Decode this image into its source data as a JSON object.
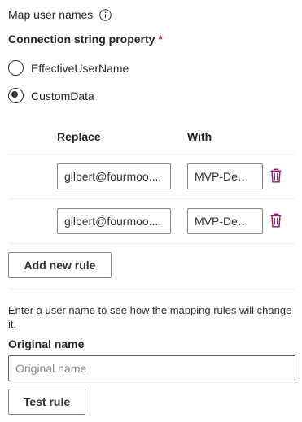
{
  "section": {
    "title": "Map user names",
    "info_icon": "info-icon"
  },
  "connection": {
    "label": "Connection string property",
    "required_marker": "*",
    "options": [
      {
        "label": "EffectiveUserName",
        "selected": false
      },
      {
        "label": "CustomData",
        "selected": true
      }
    ]
  },
  "rules_table": {
    "headers": {
      "replace": "Replace",
      "with": "With"
    },
    "rows": [
      {
        "replace": "gilbert@fourmoo....",
        "with": "MVP-Dem...",
        "delete_icon": "trash-icon"
      },
      {
        "replace": "gilbert@fourmoo....",
        "with": "MVP-Dem...",
        "delete_icon": "trash-icon"
      }
    ],
    "add_rule_label": "Add new rule"
  },
  "test": {
    "helper_text": "Enter a user name to see how the mapping rules will change it.",
    "original_name_label": "Original name",
    "original_name_placeholder": "Original name",
    "original_name_value": "",
    "test_button_label": "Test rule"
  },
  "colors": {
    "required": "#a4262c",
    "delete_icon": "#8b1a6b",
    "divider": "#edebe9"
  }
}
